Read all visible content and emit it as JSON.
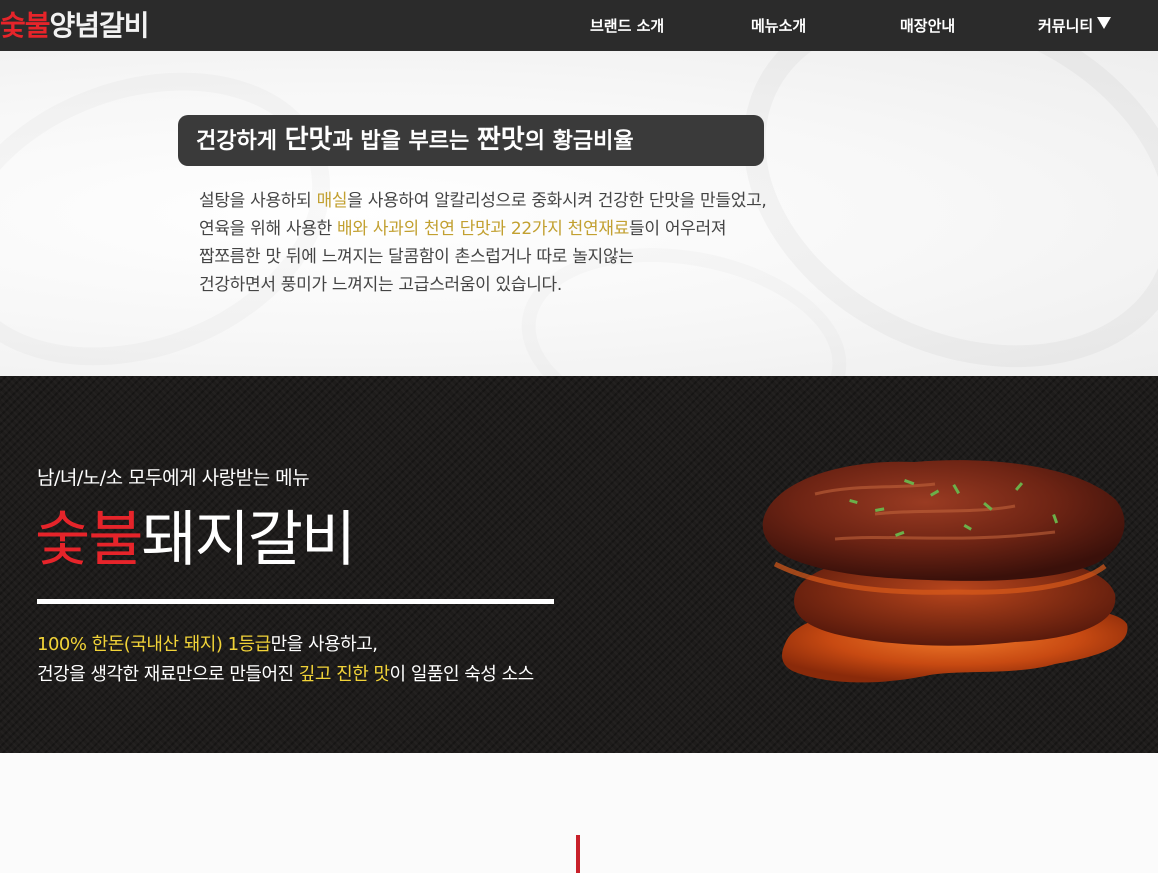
{
  "header": {
    "logo": {
      "red": "숯불",
      "white": "양념갈비"
    },
    "nav": [
      {
        "label": "브랜드 소개"
      },
      {
        "label": "메뉴소개"
      },
      {
        "label": "매장안내"
      },
      {
        "label": "커뮤니티"
      }
    ],
    "dropdown_icon": "triangle-down-icon"
  },
  "intro": {
    "headline": {
      "p1": "건강하게 ",
      "p2": "단맛",
      "p3": "과 밥을 부르는 ",
      "p4": "짠맛",
      "p5": "의 황금비율"
    },
    "lines": [
      {
        "a": "설탕을 사용하되 ",
        "b": "매실",
        "c": "을 사용하여 알칼리성으로 중화시켜 건강한 단맛을 만들었고,"
      },
      {
        "a": "연육을 위해 사용한 ",
        "b": "배와 사과의 천연 단맛과 22가지 천연재료",
        "c": "들이 어우러져"
      },
      {
        "a": "짭쪼름한 맛 뒤에 느껴지는 달콤함이 촌스럽거나 따로 놀지않는"
      },
      {
        "a": "건강하면서 풍미가 느껴지는 고급스러움이 있습니다."
      }
    ],
    "highlight_color": "#c2a030"
  },
  "banner": {
    "subtitle": "남/녀/노/소 모두에게 사랑받는 메뉴",
    "title": {
      "red": "숯불",
      "white": "돼지갈비"
    },
    "desc": {
      "l1a": "100% 한돈(국내산 돼지) 1등급",
      "l1b": "만을 사용하고,",
      "l2a": "건강을 생각한 재료만으로 만들어진 ",
      "l2b": "깊고 진한 맛",
      "l2c": "이 일품인 숙성 소스"
    },
    "highlight_color": "#f1d338",
    "image": "grilled-galbi-image"
  },
  "colors": {
    "brand_red": "#e6242a",
    "header_bg": "#2b2b2b",
    "pill_bg": "#3a3a3a"
  }
}
